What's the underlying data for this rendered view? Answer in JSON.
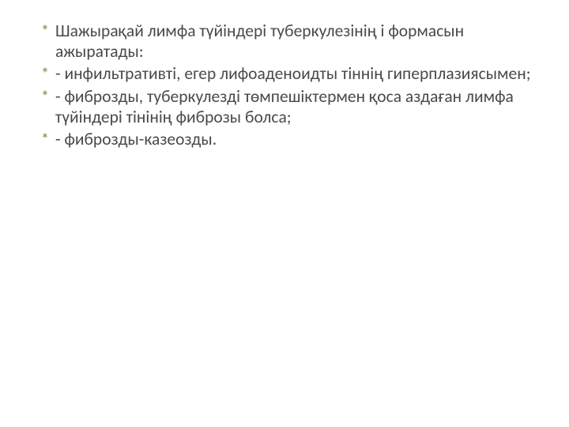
{
  "bullets": [
    "Шажырақай лимфа түйіндері туберкулезінің і формасын ажыратады:",
    "-         инфильтративті, егер лифоаденоидты тіннің гиперплазиясымен;",
    "-         фиброзды, туберкулезді төмпешіктермен қоса аздаған лимфа түйіндері тінінің фиброзы болса;",
    " -       фиброзды-казеозды."
  ]
}
